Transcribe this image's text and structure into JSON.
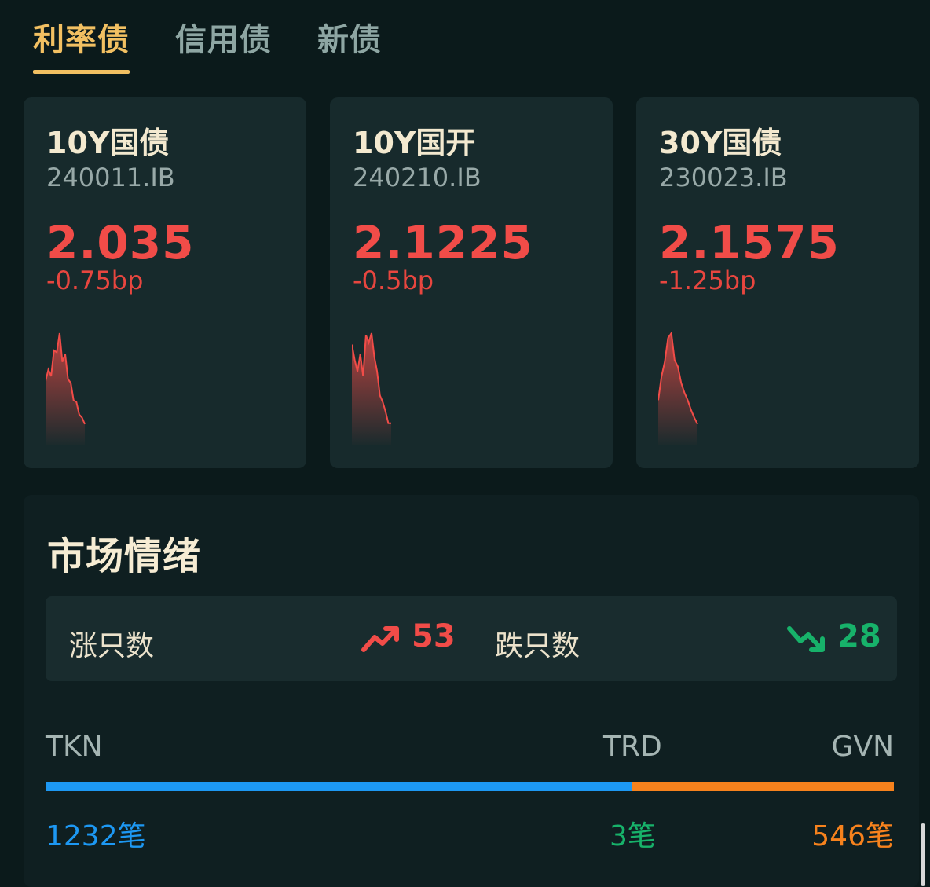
{
  "tabs": [
    {
      "label": "利率债",
      "active": true
    },
    {
      "label": "信用债",
      "active": false
    },
    {
      "label": "新债",
      "active": false
    }
  ],
  "cards": [
    {
      "name": "10Y国债",
      "code": "240011.IB",
      "yield": "2.035",
      "change": "-0.75bp",
      "spark": [
        0.5,
        0.62,
        0.55,
        0.82,
        0.8,
        1.0,
        0.7,
        0.78,
        0.52,
        0.48,
        0.3,
        0.28,
        0.15,
        0.12,
        0.05
      ]
    },
    {
      "name": "10Y国开",
      "code": "240210.IB",
      "yield": "2.1225",
      "change": "-0.5bp",
      "spark": [
        0.88,
        0.72,
        0.6,
        0.78,
        0.55,
        0.98,
        0.9,
        1.0,
        0.75,
        0.6,
        0.35,
        0.28,
        0.18,
        0.06,
        0.06
      ]
    },
    {
      "name": "30Y国债",
      "code": "230023.IB",
      "yield": "2.1575",
      "change": "-1.25bp",
      "spark": [
        0.3,
        0.55,
        0.7,
        0.95,
        1.0,
        0.72,
        0.65,
        0.48,
        0.38,
        0.3,
        0.2,
        0.12,
        0.05
      ]
    }
  ],
  "sentiment": {
    "title": "市场情绪",
    "up_label": "涨只数",
    "up_count": "53",
    "down_label": "跌只数",
    "down_count": "28",
    "labels": {
      "left": "TKN",
      "mid": "TRD",
      "right": "GVN"
    },
    "counts": {
      "left": "1232笔",
      "mid": "3笔",
      "right": "546笔"
    },
    "bar_left_fraction": 0.692
  },
  "colors": {
    "accent": "#f2c062",
    "red": "#f14c48",
    "green": "#17b26a",
    "blue": "#1d98f3",
    "orange": "#f6821d"
  },
  "icons": {
    "up": "trending-up-icon",
    "down": "trending-down-icon"
  }
}
